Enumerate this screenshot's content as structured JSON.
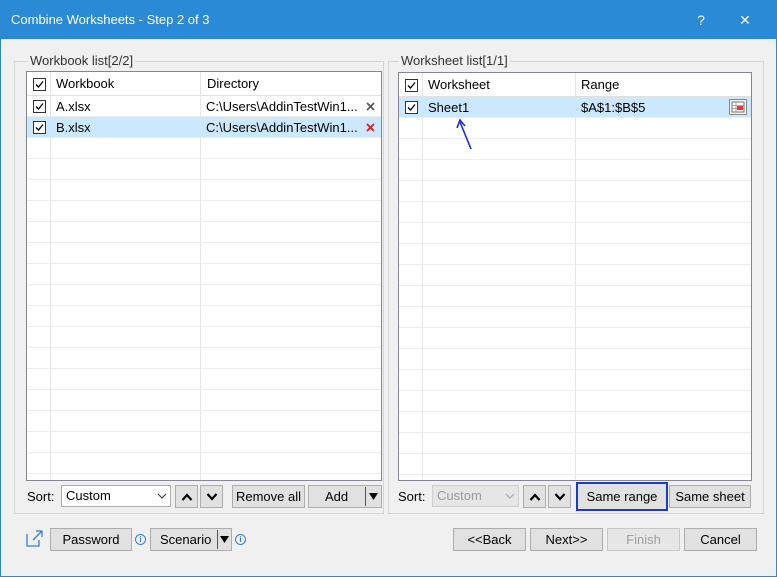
{
  "window": {
    "title": "Combine Worksheets - Step 2 of 3",
    "help_label": "?",
    "close_label": "✕"
  },
  "workbook_list": {
    "label": "Workbook list[2/2]",
    "col_workbook": "Workbook",
    "col_directory": "Directory",
    "rows": [
      {
        "name": "A.xlsx",
        "dir": "C:\\Users\\AddinTestWin1...",
        "checked": true,
        "selected": false
      },
      {
        "name": "B.xlsx",
        "dir": "C:\\Users\\AddinTestWin1...",
        "checked": true,
        "selected": true
      }
    ],
    "sort_label": "Sort:",
    "sort_value": "Custom",
    "remove_all": "Remove all",
    "add": "Add"
  },
  "worksheet_list": {
    "label": "Worksheet list[1/1]",
    "col_worksheet": "Worksheet",
    "col_range": "Range",
    "rows": [
      {
        "name": "Sheet1",
        "range": "$A$1:$B$5",
        "checked": true,
        "selected": true
      }
    ],
    "sort_label": "Sort:",
    "sort_value": "Custom",
    "same_range": "Same range",
    "same_sheet": "Same sheet"
  },
  "footer": {
    "password": "Password",
    "scenario": "Scenario",
    "back": "<<Back",
    "next": "Next>>",
    "finish": "Finish",
    "cancel": "Cancel"
  },
  "colors": {
    "titlebar": "#2b8ad5",
    "selection": "#cce8ff",
    "focus": "#1a3ccc",
    "remove_x": "#d81e1e",
    "arrow": "#1a2fd6"
  }
}
